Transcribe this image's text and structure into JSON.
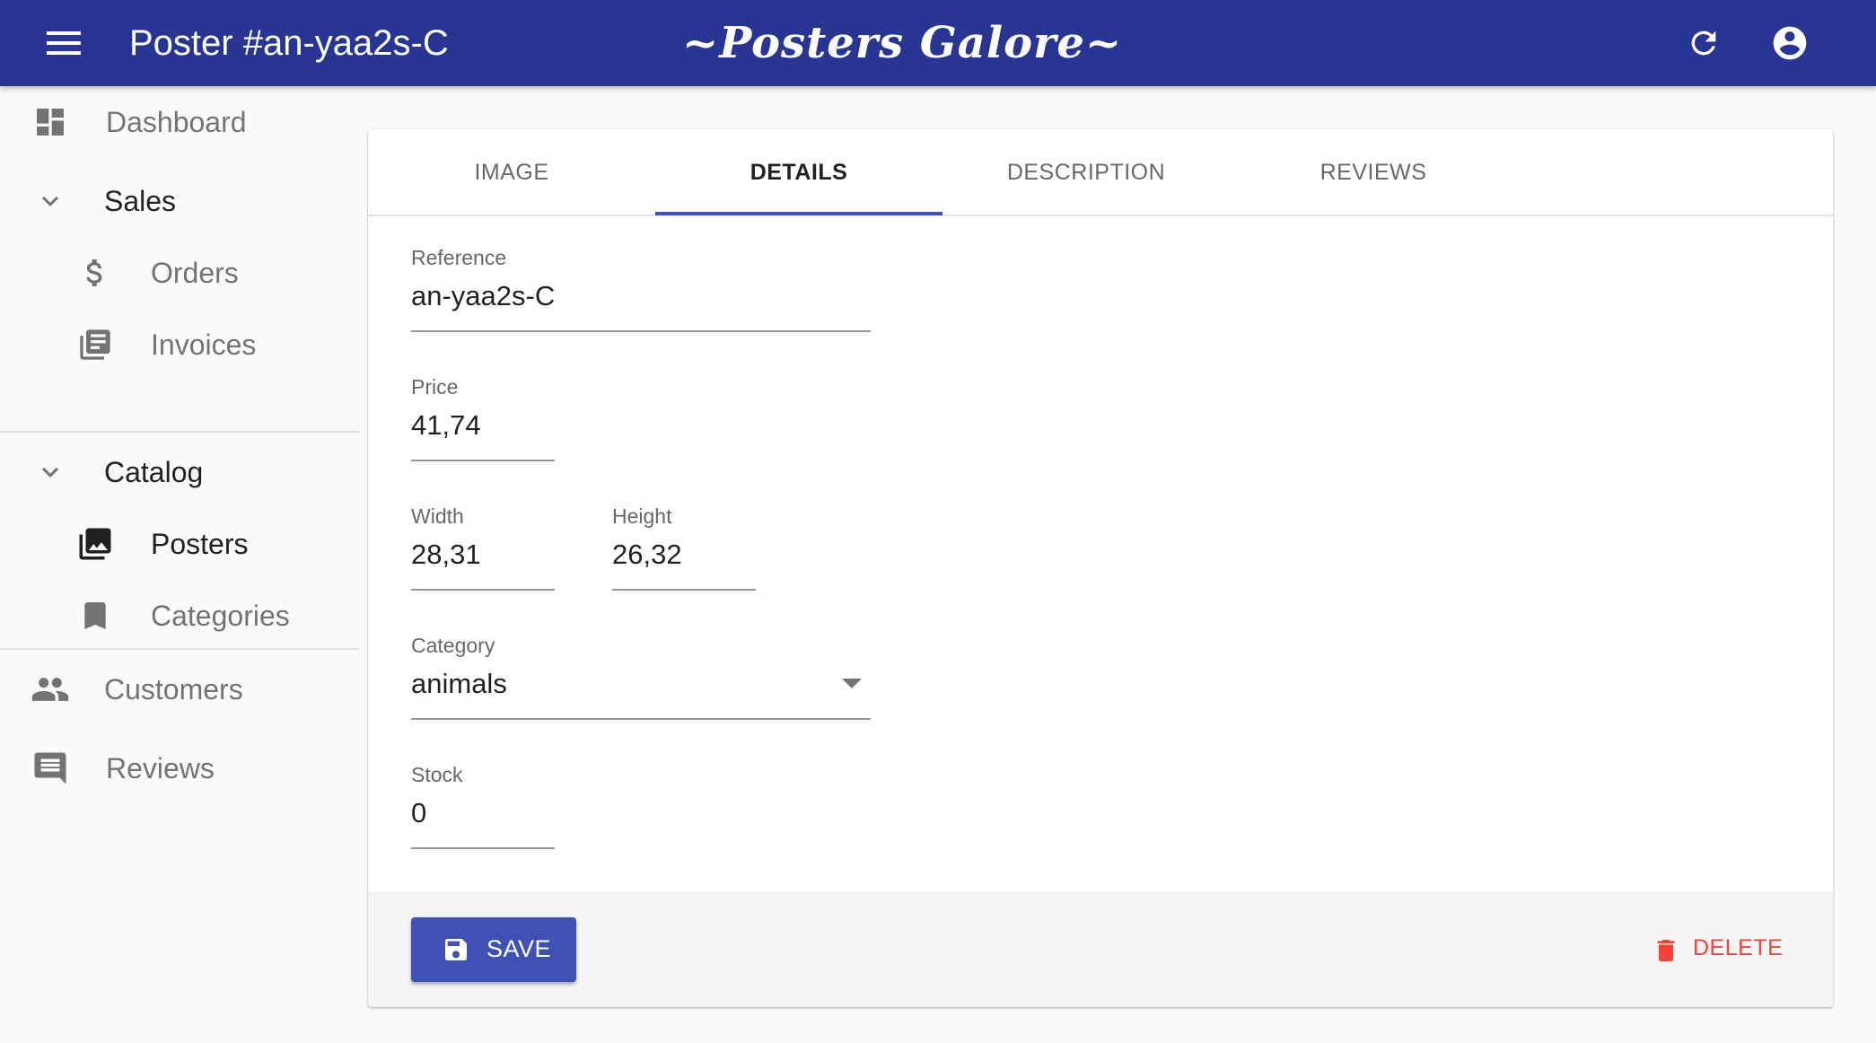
{
  "header": {
    "title": "Poster #an-yaa2s-C",
    "brand": "~Posters Galore~",
    "icons": [
      "menu-icon",
      "refresh-icon",
      "account-icon"
    ]
  },
  "sidebar": {
    "dashboard": "Dashboard",
    "sales": {
      "label": "Sales",
      "items": [
        "Orders",
        "Invoices"
      ]
    },
    "catalog": {
      "label": "Catalog",
      "items": [
        "Posters",
        "Categories"
      ]
    },
    "customers": "Customers",
    "reviews": "Reviews",
    "active_item": "Posters"
  },
  "tabs": [
    "IMAGE",
    "DETAILS",
    "DESCRIPTION",
    "REVIEWS"
  ],
  "active_tab": "DETAILS",
  "form": {
    "reference": {
      "label": "Reference",
      "value": "an-yaa2s-C"
    },
    "price": {
      "label": "Price",
      "value": "41,74"
    },
    "width": {
      "label": "Width",
      "value": "28,31"
    },
    "height": {
      "label": "Height",
      "value": "26,32"
    },
    "category": {
      "label": "Category",
      "value": "animals"
    },
    "stock": {
      "label": "Stock",
      "value": "0"
    }
  },
  "actions": {
    "save": "SAVE",
    "delete": "DELETE"
  },
  "colors": {
    "appbar": "#283593",
    "primary": "#3f51b5",
    "danger": "#f44336"
  }
}
